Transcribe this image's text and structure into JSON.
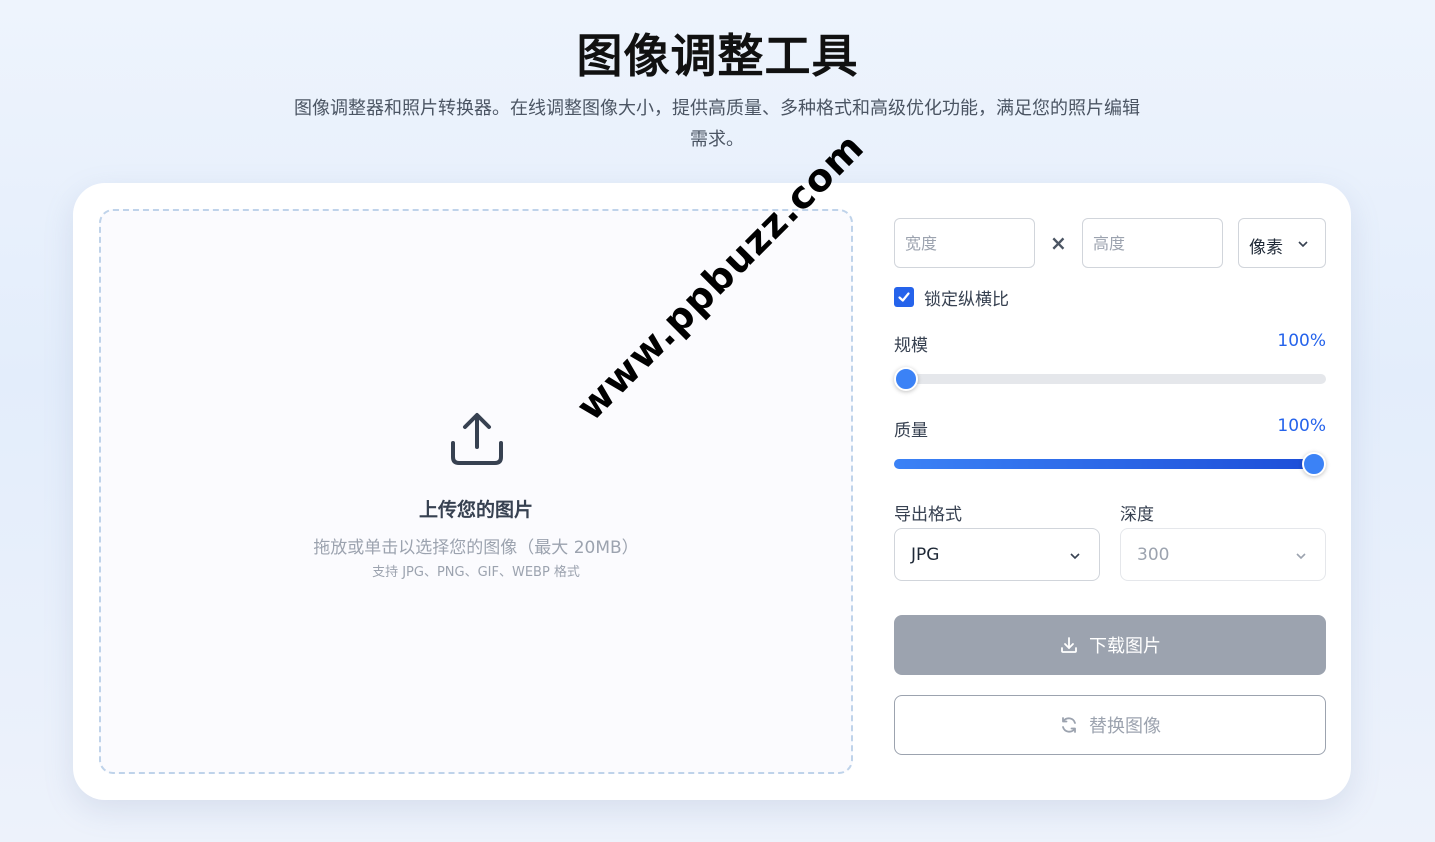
{
  "header": {
    "title": "图像调整工具",
    "subtitle": "图像调整器和照片转换器。在线调整图像大小，提供高质量、多种格式和高级优化功能，满足您的照片编辑需求。"
  },
  "upload": {
    "icon": "upload-icon",
    "title": "上传您的图片",
    "hint": "拖放或单击以选择您的图像（最大 20MB）",
    "formats": "支持 JPG、PNG、GIF、WEBP 格式"
  },
  "dimensions": {
    "width_placeholder": "宽度",
    "height_placeholder": "高度",
    "width_value": "",
    "height_value": "",
    "separator": "×",
    "unit": "像素"
  },
  "lock_aspect": {
    "label": "锁定纵横比",
    "checked": true
  },
  "scale": {
    "label": "规模",
    "value_text": "100%",
    "value": 0
  },
  "quality": {
    "label": "质量",
    "value_text": "100%",
    "value": 1.0
  },
  "export": {
    "label": "导出格式",
    "selected": "JPG"
  },
  "depth": {
    "label": "深度",
    "selected": "300"
  },
  "buttons": {
    "download": "下载图片",
    "replace": "替换图像"
  },
  "watermark": "www.ppbuzz.com",
  "colors": {
    "accent": "#2563eb",
    "disabled": "#9ca3af"
  }
}
